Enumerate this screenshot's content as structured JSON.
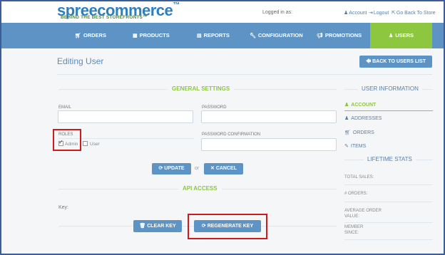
{
  "header": {
    "logo_text": "spreecommerce",
    "logo_tm": "™",
    "tagline": "BEHIND THE BEST STOREFRONTS™",
    "logged_in_as": "Logged in as:",
    "links": [
      {
        "label": "Account",
        "icon": "user-icon"
      },
      {
        "label": "Logout",
        "icon": "logout-icon"
      },
      {
        "label": "Go Back To Store",
        "icon": "external-link-icon"
      }
    ]
  },
  "nav": {
    "items": [
      {
        "label": "ORDERS",
        "icon": "cart-icon"
      },
      {
        "label": "PRODUCTS",
        "icon": "grid-icon"
      },
      {
        "label": "REPORTS",
        "icon": "file-icon"
      },
      {
        "label": "CONFIGURATION",
        "icon": "wrench-icon"
      },
      {
        "label": "PROMOTIONS",
        "icon": "bullhorn-icon"
      },
      {
        "label": "USERS",
        "icon": "user-icon"
      }
    ],
    "active_color": "#8dc63f",
    "bar_color": "#5e93c6"
  },
  "page": {
    "title": "Editing User",
    "back_button": "BACK TO USERS LIST"
  },
  "form": {
    "general_settings_title": "GENERAL SETTINGS",
    "email_label": "EMAIL",
    "password_label": "PASSWORD",
    "roles_label": "ROLES",
    "password_confirmation_label": "PASSWORD CONFIRMATION",
    "roles": [
      {
        "label": "Admin",
        "checked": true
      },
      {
        "label": "User",
        "checked": false
      }
    ],
    "update_button": "UPDATE",
    "or_text": "or",
    "cancel_button": "CANCEL",
    "api_access_title": "API ACCESS",
    "key_label": "Key:",
    "clear_key_button": "CLEAR KEY",
    "regenerate_key_button": "REGENERATE KEY"
  },
  "sidebar": {
    "user_info_title": "USER INFORMATION",
    "items": [
      {
        "label": "ACCOUNT",
        "icon": "user-icon",
        "active": true
      },
      {
        "label": "ADDRESSES",
        "icon": "user-icon",
        "active": false
      },
      {
        "label": "ORDERS",
        "icon": "cart-icon",
        "active": false
      },
      {
        "label": "ITEMS",
        "icon": "edit-icon",
        "active": false
      }
    ],
    "lifetime_stats_title": "LIFETIME STATS",
    "stats": [
      {
        "label": "TOTAL SALES:"
      },
      {
        "label": "# ORDERS:"
      },
      {
        "label": "AVERAGE ORDER VALUE:"
      },
      {
        "label": "MEMBER SINCE:"
      }
    ]
  },
  "annotation_color": "#d11a1a"
}
